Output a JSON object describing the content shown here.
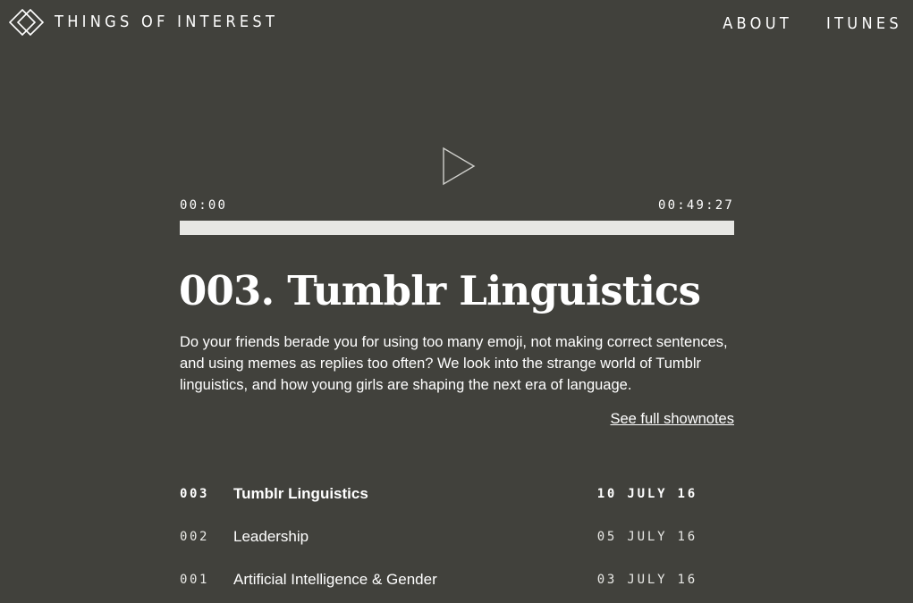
{
  "header": {
    "logo_icon": "double-diamond-logo-icon",
    "site_title": "THINGS OF INTEREST",
    "nav": [
      {
        "label": "ABOUT"
      },
      {
        "label": "ITUNES"
      }
    ]
  },
  "player": {
    "play_icon": "play-icon",
    "current_time": "00:00",
    "total_time": "00:49:27",
    "progress": 0
  },
  "episode": {
    "title": "003. Tumblr Linguistics",
    "description": "Do your friends berade you for using too many emoji, not making correct sentences, and using memes as replies too often? We look into the strange world of Tumblr linguistics, and how young girls are shaping the next era of language.",
    "shownotes_link": "See full shownotes"
  },
  "episodes": [
    {
      "number": "003",
      "name": "Tumblr Linguistics",
      "date": "10 JULY 16",
      "active": true
    },
    {
      "number": "002",
      "name": "Leadership",
      "date": "05 JULY 16",
      "active": false
    },
    {
      "number": "001",
      "name": "Artificial Intelligence & Gender",
      "date": "03 JULY 16",
      "active": false
    }
  ],
  "colors": {
    "background": "#41413c",
    "text": "#ffffff",
    "progress_track": "#e6e6e3"
  }
}
